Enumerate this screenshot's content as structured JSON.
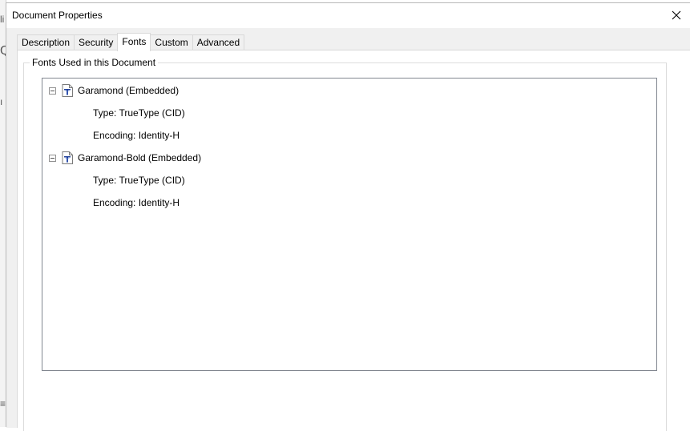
{
  "window": {
    "title": "Document Properties",
    "close_label": "×"
  },
  "tabs": [
    {
      "label": "Description",
      "active": false
    },
    {
      "label": "Security",
      "active": false
    },
    {
      "label": "Fonts",
      "active": true
    },
    {
      "label": "Custom",
      "active": false
    },
    {
      "label": "Advanced",
      "active": false
    }
  ],
  "fonts_group": {
    "legend": "Fonts Used in this Document",
    "fonts": [
      {
        "name": "Garamond (Embedded)",
        "type": "Type: TrueType (CID)",
        "encoding": "Encoding: Identity-H"
      },
      {
        "name": "Garamond-Bold (Embedded)",
        "type": "Type: TrueType (CID)",
        "encoding": "Encoding: Identity-H"
      }
    ]
  },
  "icons": {
    "font": "truetype-font-icon",
    "collapse": "tree-collapse-icon",
    "close": "close-icon"
  },
  "colors": {
    "tab_border": "#d9d9d9",
    "tree_border": "#828790",
    "dialog_bg": "#f0f0f0",
    "icon_blue": "#1f3f9a"
  }
}
